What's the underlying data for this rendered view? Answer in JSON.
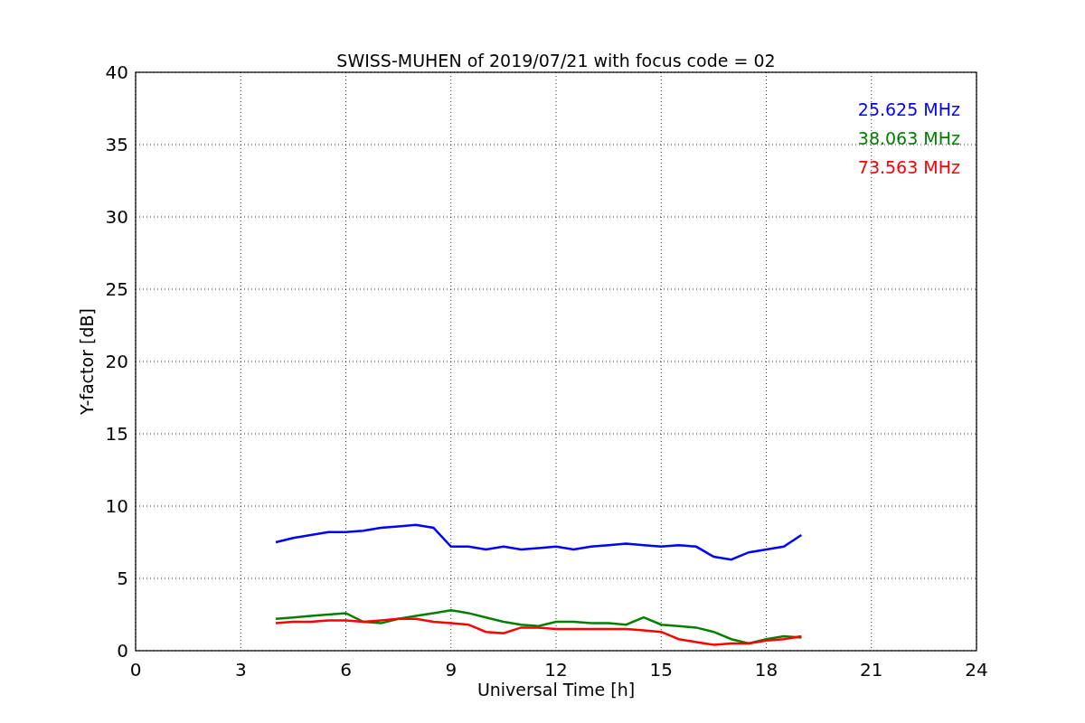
{
  "figure": {
    "chart_data": {
      "type": "line",
      "title": "SWISS-MUHEN of 2019/07/21 with focus code = 02",
      "xlabel": "Universal Time [h]",
      "ylabel": "Y-factor [dB]",
      "x": [
        4,
        4.5,
        5,
        5.5,
        6,
        6.5,
        7,
        7.5,
        8,
        8.5,
        9,
        9.5,
        10,
        10.5,
        11,
        11.5,
        12,
        12.5,
        13,
        13.5,
        14,
        14.5,
        15,
        15.5,
        16,
        16.5,
        17,
        17.5,
        18,
        18.5,
        19
      ],
      "series": [
        {
          "name": "25.625 MHz",
          "color": "#0000ff",
          "values": [
            7.5,
            7.8,
            8,
            8.2,
            8.2,
            8.3,
            8.5,
            8.6,
            8.7,
            8.5,
            7.2,
            7.2,
            7.0,
            7.2,
            7.0,
            7.1,
            7.2,
            7.0,
            7.2,
            7.3,
            7.4,
            7.3,
            7.2,
            7.3,
            7.2,
            6.5,
            6.3,
            6.8,
            7.0,
            7.2,
            8.0
          ]
        },
        {
          "name": "38.063 MHz",
          "color": "#008000",
          "values": [
            2.2,
            2.3,
            2.4,
            2.5,
            2.6,
            2.0,
            1.9,
            2.2,
            2.4,
            2.6,
            2.8,
            2.6,
            2.3,
            2.0,
            1.8,
            1.7,
            2.0,
            2.0,
            1.9,
            1.9,
            1.8,
            2.3,
            1.8,
            1.7,
            1.6,
            1.3,
            0.8,
            0.5,
            0.8,
            1.0,
            0.9
          ]
        },
        {
          "name": "73.563 MHz",
          "color": "#ff0000",
          "values": [
            1.9,
            2.0,
            2.0,
            2.1,
            2.1,
            2.0,
            2.1,
            2.2,
            2.2,
            2.0,
            1.9,
            1.8,
            1.3,
            1.2,
            1.6,
            1.6,
            1.5,
            1.5,
            1.5,
            1.5,
            1.5,
            1.4,
            1.3,
            0.8,
            0.6,
            0.4,
            0.5,
            0.5,
            0.7,
            0.8,
            1.0
          ]
        }
      ],
      "xlim": [
        0,
        24
      ],
      "ylim": [
        0,
        40
      ],
      "xticks": [
        0,
        3,
        6,
        9,
        12,
        15,
        18,
        21,
        24
      ],
      "yticks": [
        0,
        5,
        10,
        15,
        20,
        25,
        30,
        35,
        40
      ],
      "grid": true
    }
  }
}
